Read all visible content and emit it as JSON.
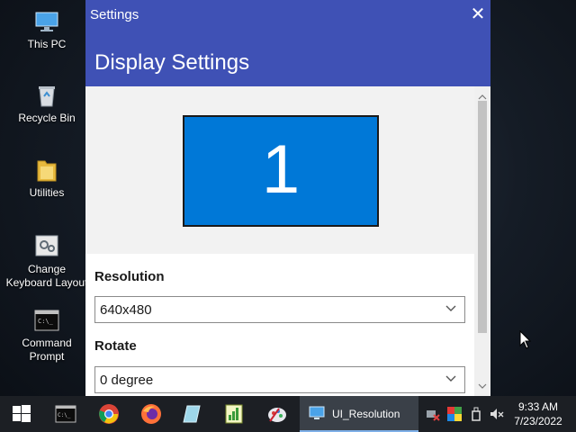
{
  "desktop": {
    "icons": [
      {
        "label": "This PC",
        "icon": "this-pc-icon"
      },
      {
        "label": "Recycle Bin",
        "icon": "recycle-bin-icon"
      },
      {
        "label": "Utilities",
        "icon": "folder-icon"
      },
      {
        "label": "Change Keyboard Layout",
        "icon": "keyboard-settings-icon"
      },
      {
        "label": "Command Prompt",
        "icon": "command-prompt-icon"
      }
    ]
  },
  "window": {
    "title": "Settings",
    "close_glyph": "✕",
    "header": "Display Settings",
    "monitor_number": "1",
    "resolution_label": "Resolution",
    "resolution_value": "640x480",
    "rotate_label": "Rotate",
    "rotate_value": "0 degree"
  },
  "taskbar": {
    "active_app_label": "UI_Resolution",
    "pinned": [
      "start-icon",
      "terminal-icon",
      "chrome-icon",
      "firefox-icon",
      "notepad-icon",
      "chart-app-icon",
      "paint-icon"
    ],
    "tray": [
      "network-icon",
      "color-app-icon",
      "usb-icon",
      "volume-muted-icon"
    ],
    "time": "9:33 AM",
    "date": "7/23/2022"
  },
  "colors": {
    "accent": "#3f51b5",
    "monitor": "#0078d7",
    "taskbar": "#1c1f24"
  }
}
